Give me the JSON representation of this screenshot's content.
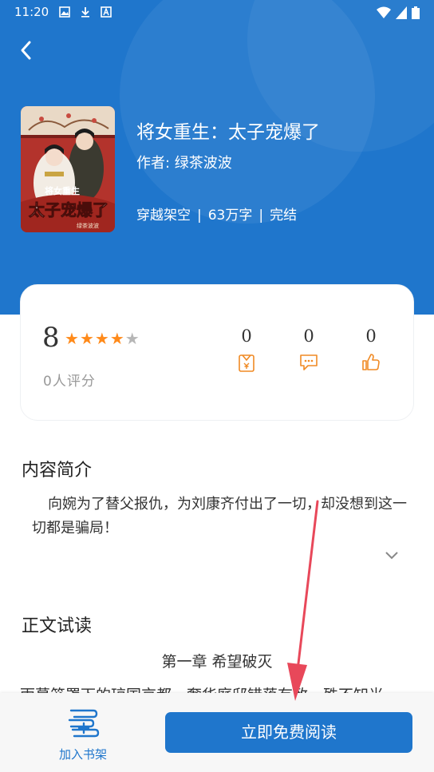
{
  "status_bar": {
    "time": "11:20"
  },
  "book": {
    "title": "将女重生：太子宠爆了",
    "author": "作者: 绿茶波波",
    "genre": "穿越架空",
    "word_count": "63万字",
    "status": "完结",
    "separator": "|"
  },
  "cover": {
    "cover_title_top": "将女重生",
    "cover_title_main": "太子宠爆了",
    "cover_author": "绿茶波波"
  },
  "rating": {
    "score": "8",
    "stars_filled": 4,
    "stars_total": 5,
    "count_label": "0人评分"
  },
  "stats": {
    "ticket_count": "0",
    "comment_count": "0",
    "like_count": "0"
  },
  "intro": {
    "heading": "内容简介",
    "text": "向婉为了替父报仇，为刘康齐付出了一切，却没想到这一切都是骗局！"
  },
  "preview": {
    "heading": "正文试读",
    "chapter_title": "第一章 希望破灭",
    "first_line": "雨幕笼罩下的琼国京都，奢华庭邸错落有致，殊不知光"
  },
  "bottom": {
    "shelf_label": "加入书架",
    "read_label": "立即免费阅读"
  },
  "colors": {
    "primary": "#1f76cc",
    "star": "#ff8a1a",
    "stat_icon": "#f08a24",
    "annotation_arrow": "#e8485a"
  }
}
